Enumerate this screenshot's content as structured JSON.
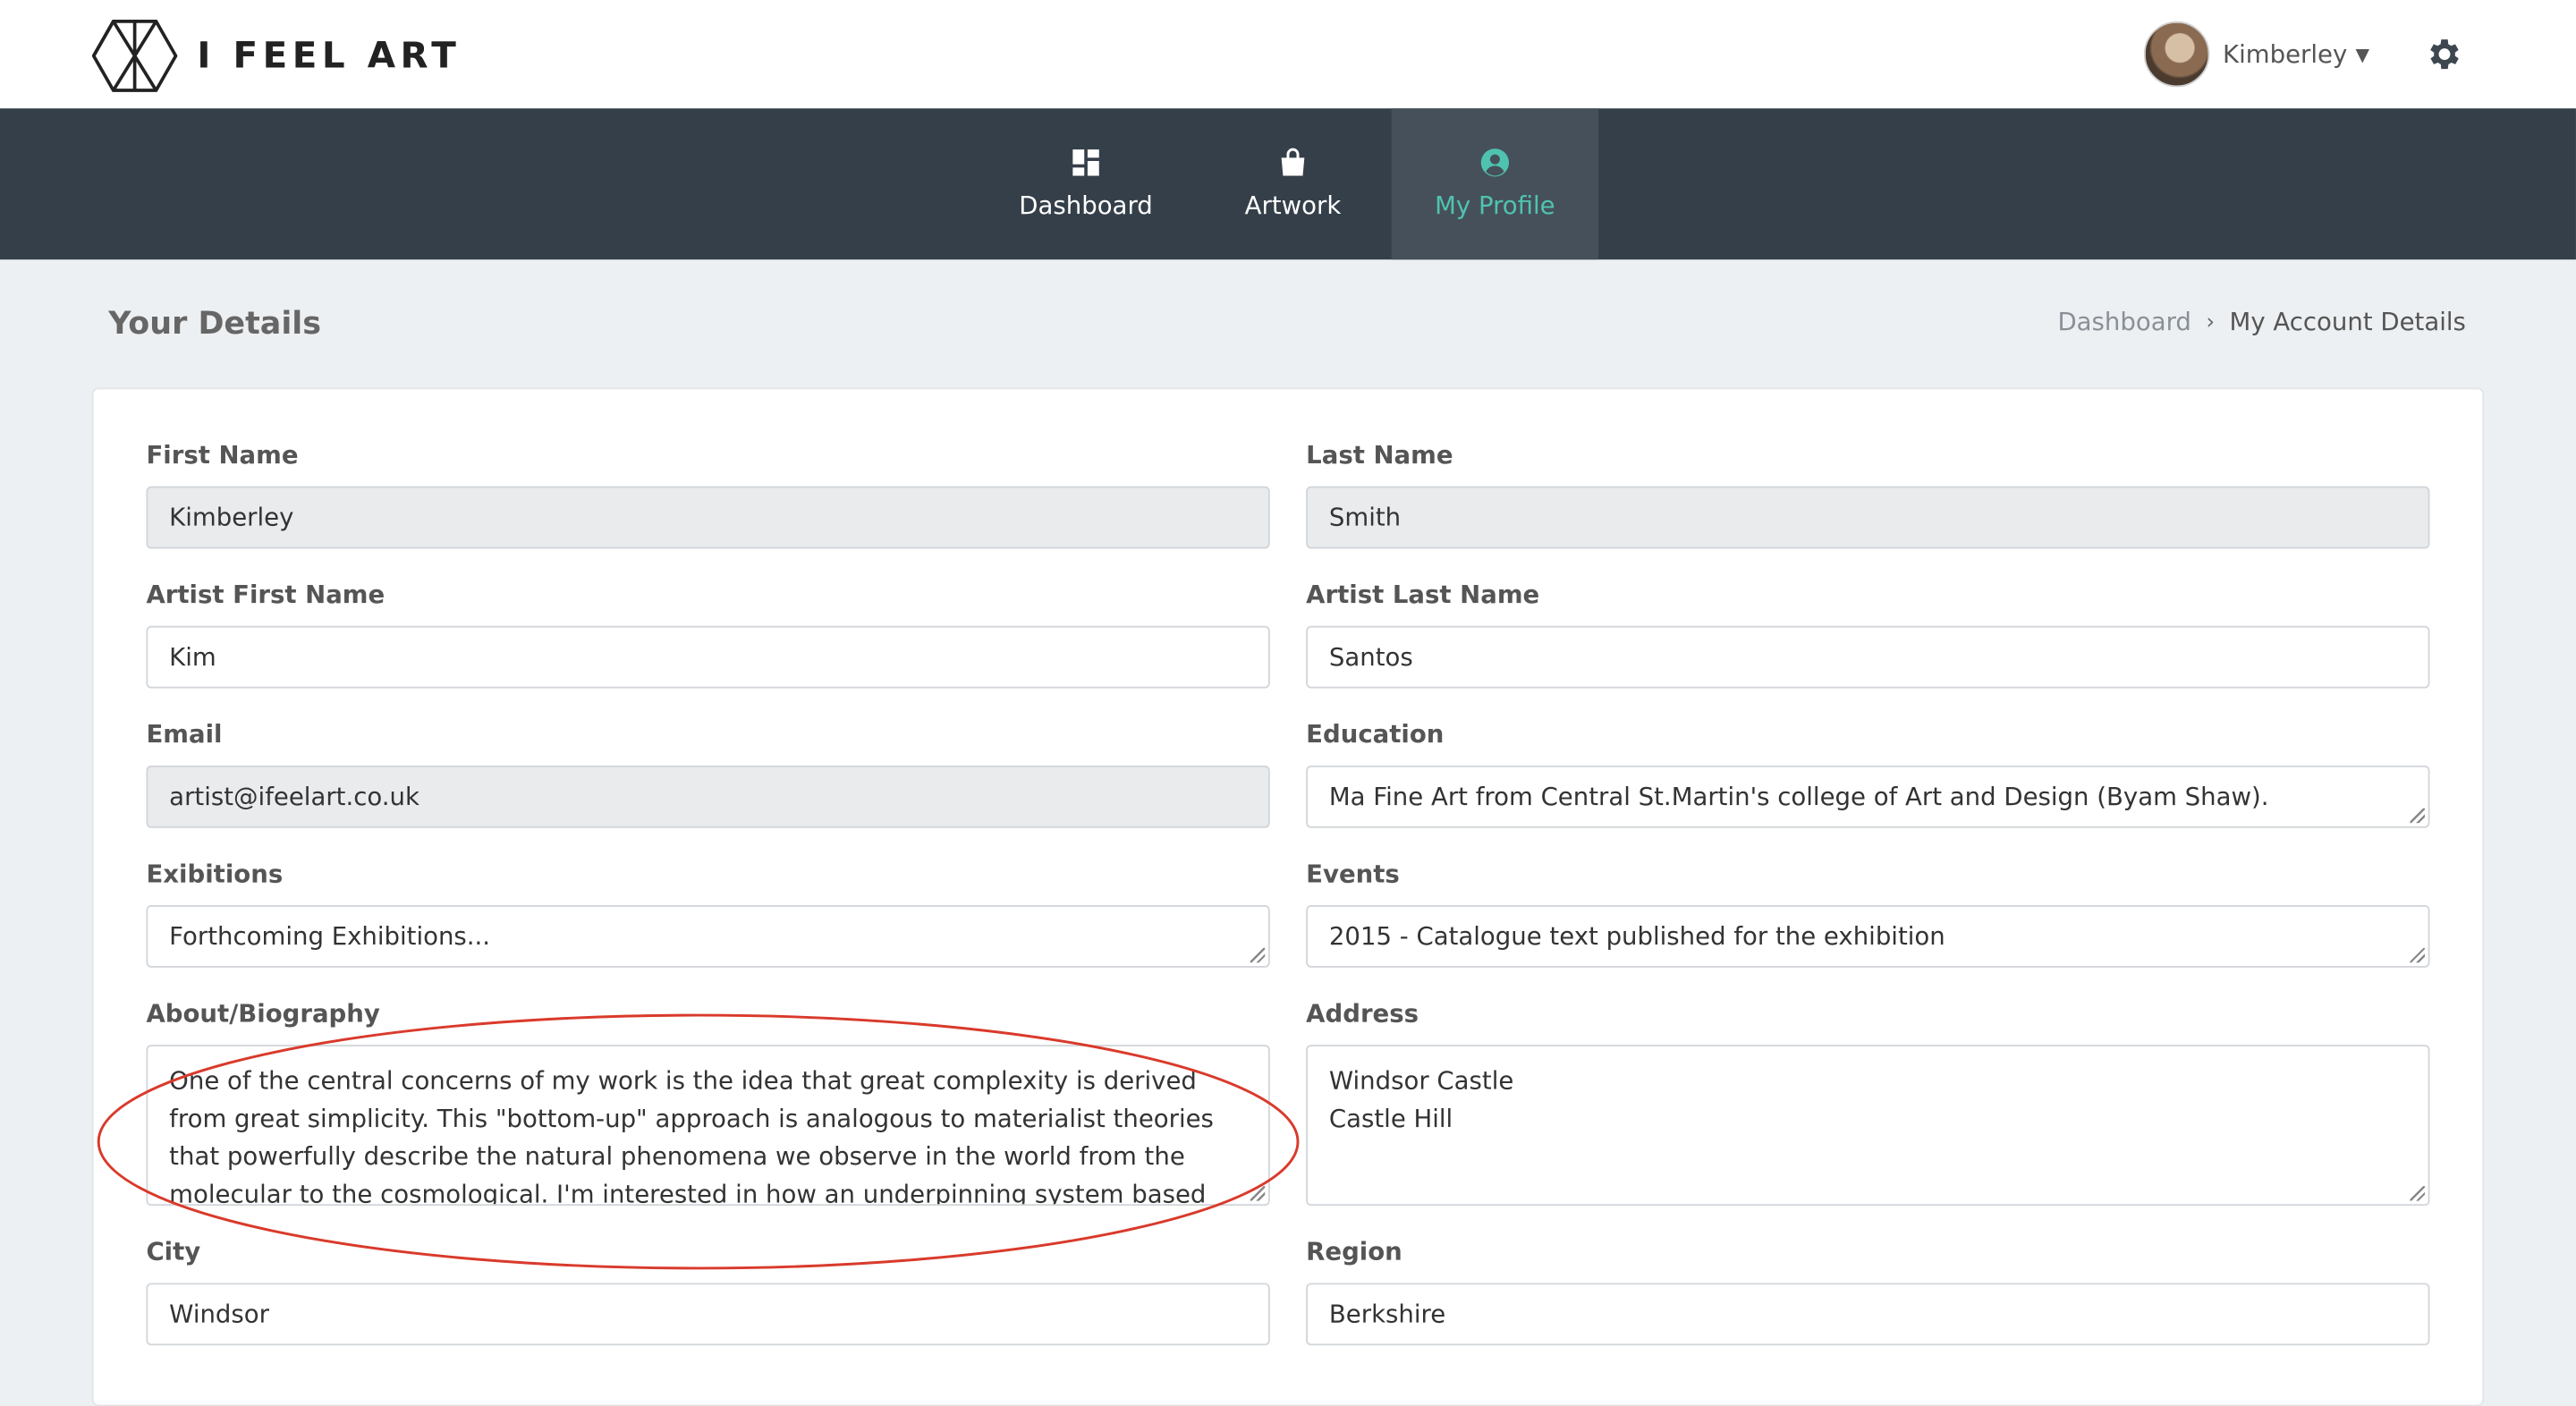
{
  "app": {
    "brand": "I FEEL ART"
  },
  "user": {
    "name": "Kimberley"
  },
  "nav": {
    "tabs": [
      {
        "id": "dashboard",
        "label": "Dashboard",
        "icon": "dashboard-icon"
      },
      {
        "id": "artwork",
        "label": "Artwork",
        "icon": "shopping-bag-icon"
      },
      {
        "id": "profile",
        "label": "My Profile",
        "icon": "user-circle-icon",
        "active": true
      }
    ]
  },
  "page": {
    "title": "Your Details",
    "breadcrumb": {
      "home": "Dashboard",
      "current": "My Account Details"
    }
  },
  "form": {
    "first_name": {
      "label": "First Name",
      "value": "Kimberley",
      "readonly": true
    },
    "last_name": {
      "label": "Last Name",
      "value": "Smith",
      "readonly": true
    },
    "artist_first_name": {
      "label": "Artist First Name",
      "value": "Kim"
    },
    "artist_last_name": {
      "label": "Artist Last Name",
      "value": "Santos"
    },
    "email": {
      "label": "Email",
      "value": "artist@ifeelart.co.uk",
      "readonly": true
    },
    "education": {
      "label": "Education",
      "value": "Ma Fine Art from Central St.Martin's college of Art and Design (Byam Shaw)."
    },
    "exhibitions": {
      "label": "Exibitions",
      "value": "Forthcoming Exhibitions..."
    },
    "events": {
      "label": "Events",
      "value": "2015 - Catalogue text published for the exhibition"
    },
    "biography": {
      "label": "About/Biography",
      "value": "One of the central concerns of my work is the idea that great complexity is derived from great simplicity. This \"bottom-up\" approach is analogous to materialist theories that powerfully describe the natural phenomena we observe in the world from the molecular to the cosmological. I'm interested in how an underpinning system based on a few basic"
    },
    "address": {
      "label": "Address",
      "line1": "Windsor Castle",
      "line2": "Castle Hill"
    },
    "city": {
      "label": "City",
      "value": "Windsor"
    },
    "region": {
      "label": "Region",
      "value": "Berkshire"
    }
  },
  "colors": {
    "accent": "#4fc3b0",
    "navbar": "#353f49",
    "annotation": "#d93a2b"
  }
}
